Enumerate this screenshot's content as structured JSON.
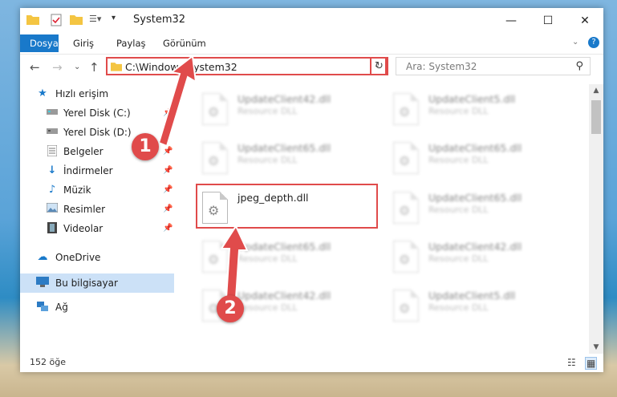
{
  "window": {
    "title": "System32",
    "controls": {
      "minimize": "—",
      "maximize": "☐",
      "close": "✕"
    }
  },
  "ribbon": {
    "tabs": [
      "Dosya",
      "Giriş",
      "Paylaş",
      "Görünüm"
    ]
  },
  "nav": {
    "address": "C:\\Windows\\System32",
    "search_placeholder": "Ara: System32"
  },
  "sidebar": {
    "items": [
      {
        "label": "Hızlı erişim",
        "icon": "star-icon"
      },
      {
        "label": "Yerel Disk (C:)",
        "icon": "drive-icon"
      },
      {
        "label": "Yerel Disk (D:)",
        "icon": "drive-icon"
      },
      {
        "label": "Belgeler",
        "icon": "documents-icon"
      },
      {
        "label": "İndirmeler",
        "icon": "download-icon"
      },
      {
        "label": "Müzik",
        "icon": "music-icon"
      },
      {
        "label": "Resimler",
        "icon": "pictures-icon"
      },
      {
        "label": "Videolar",
        "icon": "video-icon"
      },
      {
        "label": "OneDrive",
        "icon": "cloud-icon"
      },
      {
        "label": "Bu bilgisayar",
        "icon": "computer-icon"
      },
      {
        "label": "Ağ",
        "icon": "network-icon"
      }
    ]
  },
  "files": {
    "col1": [
      {
        "name": "UpdateClient42.dll",
        "sub": "Resource DLL"
      },
      {
        "name": "UpdateClient65.dll",
        "sub": "Resource DLL"
      },
      {
        "name": "jpeg_depth.dll",
        "sub": ""
      },
      {
        "name": "UpdateClient65.dll",
        "sub": "Resource DLL"
      },
      {
        "name": "UpdateClient42.dll",
        "sub": "Resource DLL"
      }
    ],
    "col2": [
      {
        "name": "UpdateClient5.dll",
        "sub": "Resource DLL"
      },
      {
        "name": "UpdateClient65.dll",
        "sub": "Resource DLL"
      },
      {
        "name": "UpdateClient65.dll",
        "sub": "Resource DLL"
      },
      {
        "name": "UpdateClient42.dll",
        "sub": "Resource DLL"
      },
      {
        "name": "UpdateClient5.dll",
        "sub": "Resource DLL"
      }
    ]
  },
  "status": {
    "count": "152 öğe"
  },
  "callouts": {
    "one": "1",
    "two": "2"
  },
  "colors": {
    "accent": "#1979ca",
    "annotation": "#e04b4b"
  }
}
